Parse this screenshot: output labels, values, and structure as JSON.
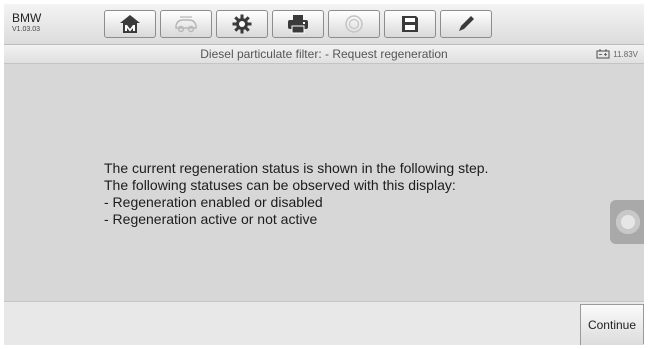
{
  "app": {
    "brand": "BMW",
    "version": "V1.03.03"
  },
  "toolbar": {
    "buttons": [
      {
        "icon": "home-icon"
      },
      {
        "icon": "vehicle-swap-icon"
      },
      {
        "icon": "settings-gear-icon"
      },
      {
        "icon": "print-icon"
      },
      {
        "icon": "help-icon"
      },
      {
        "icon": "save-icon"
      },
      {
        "icon": "edit-pen-icon"
      }
    ]
  },
  "header": {
    "title": "Diesel particulate filter: - Request regeneration",
    "battery_voltage": "11.83V"
  },
  "main": {
    "message_lines": [
      "The current regeneration status is shown in the following step.",
      "The following statuses can be observed with this display:",
      "- Regeneration enabled or disabled",
      "- Regeneration active or not active"
    ]
  },
  "footer": {
    "continue_label": "Continue"
  },
  "colors": {
    "content_bg": "#d7d7d7",
    "toolbar_bg": "#eaeaea",
    "text": "#1c1c1c"
  }
}
